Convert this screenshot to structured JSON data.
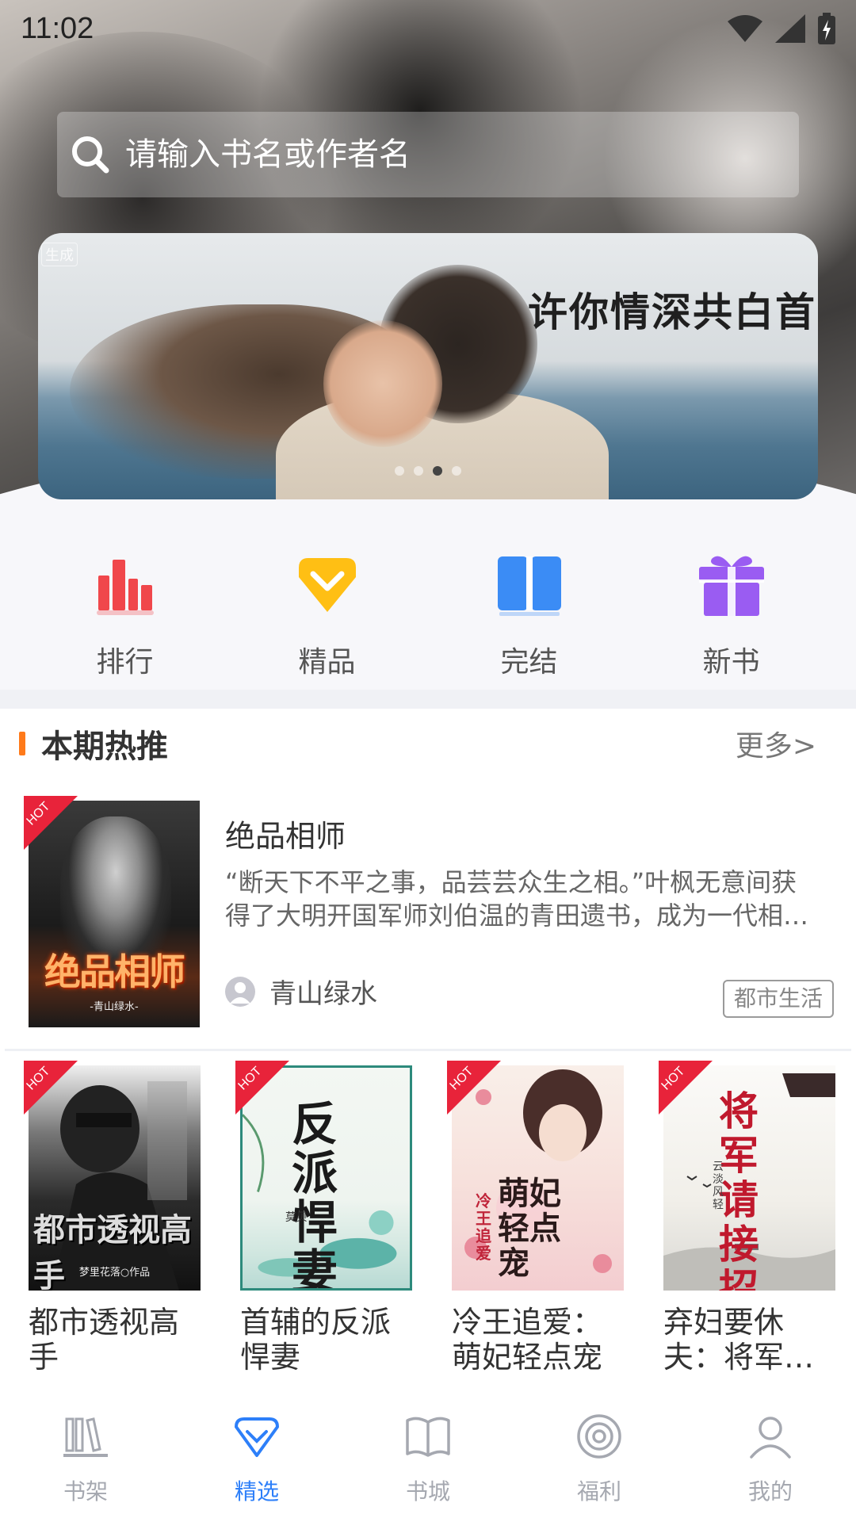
{
  "status_bar": {
    "time": "11:02"
  },
  "search": {
    "placeholder": "请输入书名或作者名"
  },
  "banner": {
    "title": "许你情深共白首",
    "tag": "生成",
    "dots": 4,
    "active_dot": 3
  },
  "categories": [
    {
      "label": "排行",
      "icon": "bar-chart-icon",
      "color": "#f0474b"
    },
    {
      "label": "精品",
      "icon": "diamond-icon",
      "color": "#ffbf14"
    },
    {
      "label": "完结",
      "icon": "open-book-icon",
      "color": "#3b8cf5"
    },
    {
      "label": "新书",
      "icon": "gift-icon",
      "color": "#9a5cf2"
    }
  ],
  "section": {
    "title": "本期热推",
    "more": "更多>"
  },
  "featured": {
    "badge": "HOT",
    "title": "绝品相师",
    "cover_title": "绝品相师",
    "cover_author": "-青山绿水-",
    "description": "“断天下不平之事，品芸芸众生之相。”叶枫无意间获得了大明开国军师刘伯温的青田遗书，成为一代相师，从此开启了不平凡的人生……",
    "author": "青山绿水",
    "genre": "都市生活"
  },
  "grid_books": [
    {
      "title": "都市透视高手",
      "badge": "HOT",
      "cover_text": "都市透视高手",
      "cover_sub": "梦里花落○作品"
    },
    {
      "title": "首辅的反派悍妻",
      "badge": "HOT",
      "cover_text": "反派悍妻",
      "cover_sub": "莫贝"
    },
    {
      "title": "冷王追爱：萌妃轻点宠",
      "badge": "HOT",
      "cover_text": "萌妃轻点宠",
      "cover_sub": "冷王追爱"
    },
    {
      "title": "弃妇要休夫：将军请接招",
      "badge": "HOT",
      "cover_text": "将军请接招",
      "cover_sub": "云淡风轻"
    }
  ],
  "tab_bar": [
    {
      "label": "书架",
      "icon": "bookshelf-icon",
      "active": false
    },
    {
      "label": "精选",
      "icon": "featured-diamond-icon",
      "active": true
    },
    {
      "label": "书城",
      "icon": "book-store-icon",
      "active": false
    },
    {
      "label": "福利",
      "icon": "welfare-icon",
      "active": false
    },
    {
      "label": "我的",
      "icon": "profile-icon",
      "active": false
    }
  ],
  "colors": {
    "accent": "#2d7ff9",
    "section_mark": "#ff7a1a",
    "hot_badge": "#e8233a",
    "tab_inactive": "#a5a8b0"
  }
}
